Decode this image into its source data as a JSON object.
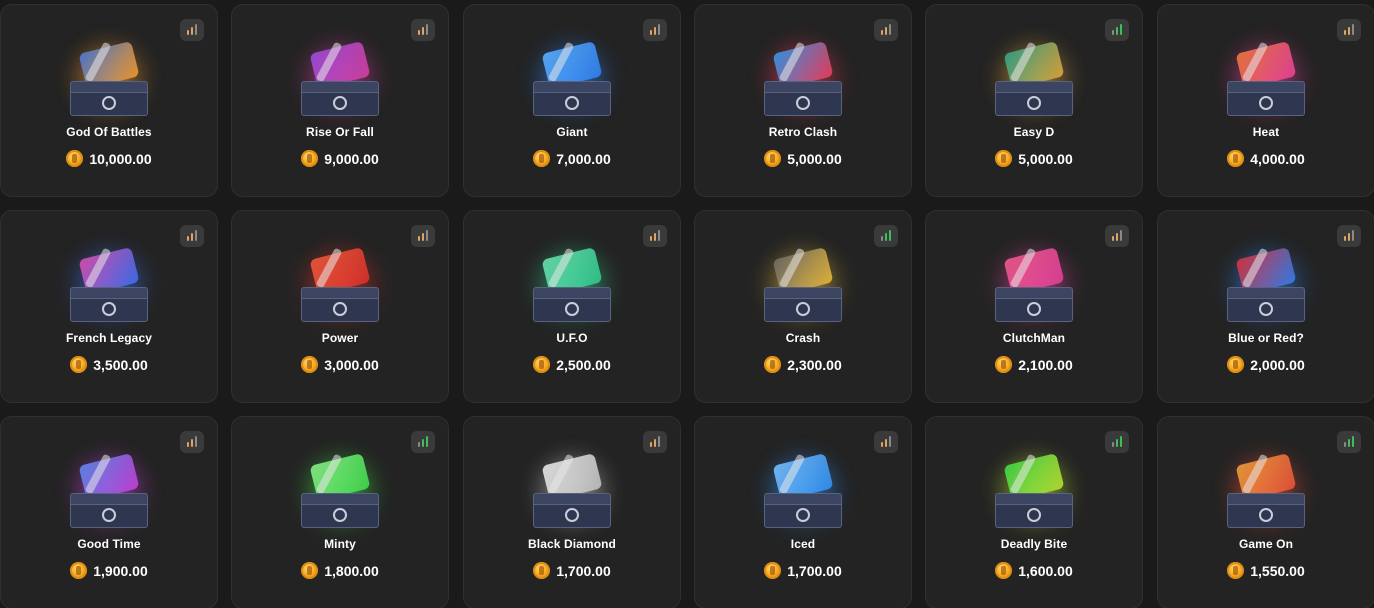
{
  "cases": [
    {
      "name": "God Of Battles",
      "price": "10,000.00",
      "rarity": "orange",
      "glow": "#f59a2a",
      "accent": "#4a7ad8"
    },
    {
      "name": "Rise Or Fall",
      "price": "9,000.00",
      "rarity": "orange",
      "glow": "#d43fa0",
      "accent": "#9b4de0"
    },
    {
      "name": "Giant",
      "price": "7,000.00",
      "rarity": "orange",
      "glow": "#2f7ff0",
      "accent": "#5bb1ff"
    },
    {
      "name": "Retro Clash",
      "price": "5,000.00",
      "rarity": "orange",
      "glow": "#ef3b5a",
      "accent": "#2f9bf0"
    },
    {
      "name": "Easy D",
      "price": "5,000.00",
      "rarity": "green",
      "glow": "#e0a53a",
      "accent": "#2fa58a"
    },
    {
      "name": "Heat",
      "price": "4,000.00",
      "rarity": "orange",
      "glow": "#e8409a",
      "accent": "#f07a3a"
    },
    {
      "name": "French Legacy",
      "price": "3,500.00",
      "rarity": "orange",
      "glow": "#3a6ef0",
      "accent": "#e04fb0"
    },
    {
      "name": "Power",
      "price": "3,000.00",
      "rarity": "orange",
      "glow": "#d8302a",
      "accent": "#f05a3a"
    },
    {
      "name": "U.F.O",
      "price": "2,500.00",
      "rarity": "orange",
      "glow": "#2fc78a",
      "accent": "#6ae0b0"
    },
    {
      "name": "Crash",
      "price": "2,300.00",
      "rarity": "green",
      "glow": "#e8b83a",
      "accent": "#6a6a6a"
    },
    {
      "name": "ClutchMan",
      "price": "2,100.00",
      "rarity": "orange",
      "glow": "#e0409a",
      "accent": "#f05a8a"
    },
    {
      "name": "Blue or Red?",
      "price": "2,000.00",
      "rarity": "orange",
      "glow": "#2f7ff0",
      "accent": "#e0303a"
    },
    {
      "name": "Good Time",
      "price": "1,900.00",
      "rarity": "orange",
      "glow": "#c43fd8",
      "accent": "#5b8af0"
    },
    {
      "name": "Minty",
      "price": "1,800.00",
      "rarity": "green",
      "glow": "#3fd84a",
      "accent": "#8af08a"
    },
    {
      "name": "Black Diamond",
      "price": "1,700.00",
      "rarity": "orange",
      "glow": "#bdbdbd",
      "accent": "#e8e8e8"
    },
    {
      "name": "Iced",
      "price": "1,700.00",
      "rarity": "orange",
      "glow": "#2f8ff0",
      "accent": "#7ac0ff"
    },
    {
      "name": "Deadly Bite",
      "price": "1,600.00",
      "rarity": "green",
      "glow": "#b8e030",
      "accent": "#3fd84a"
    },
    {
      "name": "Game On",
      "price": "1,550.00",
      "rarity": "green",
      "glow": "#e8503a",
      "accent": "#f0a03a"
    }
  ],
  "currency_icon": "coin-icon",
  "rarity_icon": "signal-bars-icon"
}
